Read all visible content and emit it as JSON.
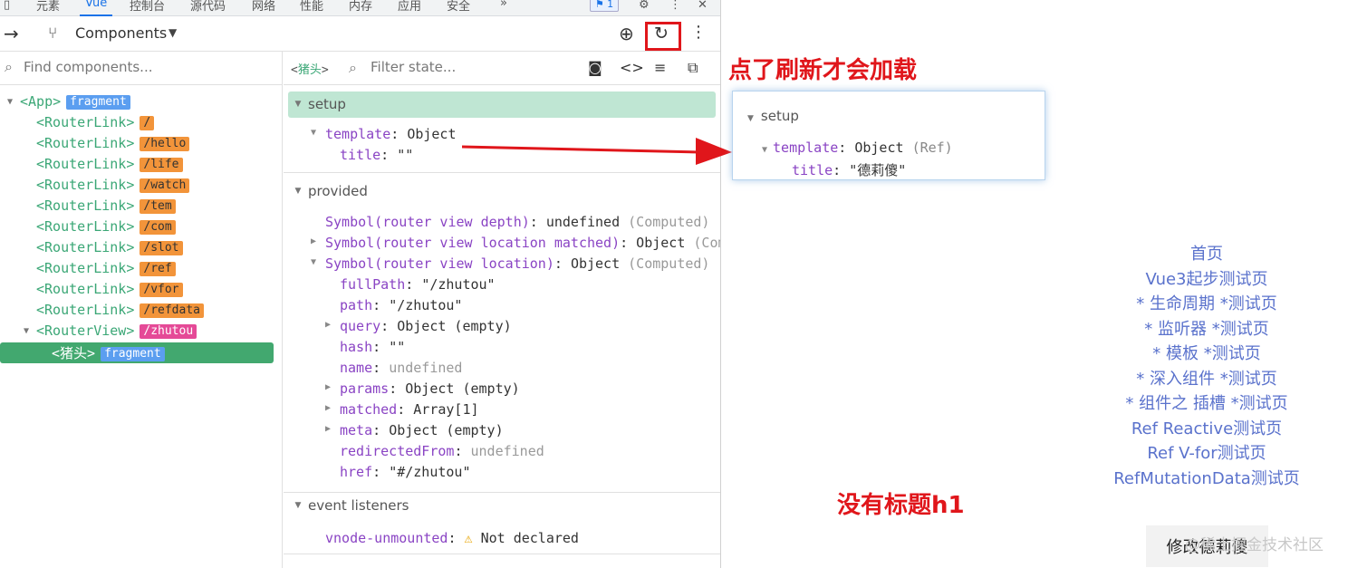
{
  "devtools": {
    "tabs": [
      "元素",
      "Vue",
      "控制台",
      "源代码",
      "网络",
      "性能",
      "内存",
      "应用",
      "安全",
      "»"
    ],
    "issues_badge": "1",
    "toolbar": {
      "components_label": "Components"
    },
    "component_search_placeholder": "Find components...",
    "tree": [
      {
        "name": "<App>",
        "badge": "fragment",
        "badge_color": "blue"
      },
      {
        "name": "<RouterLink>",
        "badge": "/",
        "badge_color": "orange"
      },
      {
        "name": "<RouterLink>",
        "badge": "/hello",
        "badge_color": "orange"
      },
      {
        "name": "<RouterLink>",
        "badge": "/life",
        "badge_color": "orange"
      },
      {
        "name": "<RouterLink>",
        "badge": "/watch",
        "badge_color": "orange"
      },
      {
        "name": "<RouterLink>",
        "badge": "/tem",
        "badge_color": "orange"
      },
      {
        "name": "<RouterLink>",
        "badge": "/com",
        "badge_color": "orange"
      },
      {
        "name": "<RouterLink>",
        "badge": "/slot",
        "badge_color": "orange"
      },
      {
        "name": "<RouterLink>",
        "badge": "/ref",
        "badge_color": "orange"
      },
      {
        "name": "<RouterLink>",
        "badge": "/vfor",
        "badge_color": "orange"
      },
      {
        "name": "<RouterLink>",
        "badge": "/refdata",
        "badge_color": "orange"
      },
      {
        "name": "<RouterView>",
        "badge": "/zhutou",
        "badge_color": "pink"
      },
      {
        "name": "<猪头>",
        "badge": "fragment",
        "badge_color": "blue"
      }
    ],
    "state": {
      "breadcrumb_open": "<",
      "breadcrumb_name": "猪头",
      "breadcrumb_close": ">",
      "filter_placeholder": "Filter state...",
      "setup_label": "setup",
      "template_key": "template",
      "template_val": "Object",
      "title_key": "title",
      "title_val": "\"\"",
      "provided_label": "provided",
      "provided": [
        {
          "k": "Symbol(router view depth)",
          "v": "undefined",
          "g": "(Computed)"
        },
        {
          "k": "Symbol(router view location matched)",
          "v": "Object",
          "g": "(Computed)"
        },
        {
          "k": "Symbol(router view location)",
          "v": "Object",
          "g": "(Computed)"
        }
      ],
      "location": [
        {
          "k": "fullPath",
          "v": "\"/zhutou\"",
          "g": ""
        },
        {
          "k": "path",
          "v": "\"/zhutou\"",
          "g": ""
        },
        {
          "k": "query",
          "v": "Object (empty)",
          "g": ""
        },
        {
          "k": "hash",
          "v": "\"\"",
          "g": ""
        },
        {
          "k": "name",
          "v": "",
          "g": "undefined"
        },
        {
          "k": "params",
          "v": "Object (empty)",
          "g": ""
        },
        {
          "k": "matched",
          "v": "Array[1]",
          "g": ""
        },
        {
          "k": "meta",
          "v": "Object (empty)",
          "g": ""
        },
        {
          "k": "redirectedFrom",
          "v": "",
          "g": "undefined"
        },
        {
          "k": "href",
          "v": "\"#/zhutou\"",
          "g": ""
        }
      ],
      "events_label": "event listeners",
      "event_key": "vnode-unmounted",
      "event_val": "Not declared"
    }
  },
  "annotations": {
    "top": "点了刷新才会加载",
    "bottom": "没有标题h1"
  },
  "popup": {
    "setup_label": "setup",
    "template_key": "template",
    "template_val": "Object",
    "template_ref": "(Ref)",
    "title_key": "title",
    "title_val": "\"德莉傻\""
  },
  "app": {
    "nav": [
      "首页",
      "Vue3起步测试页",
      "* 生命周期 *测试页",
      "* 监听器 *测试页",
      "* 模板 *测试页",
      "* 深入组件 *测试页",
      "* 组件之 插槽 *测试页",
      "Ref Reactive测试页",
      "Ref V-for测试页",
      "RefMutationData测试页"
    ],
    "edit_button": "修改德莉傻",
    "watermark": "@稀土掘金技术社区"
  },
  "colors": {
    "accent": "#1a73e8",
    "vue_green": "#42a86f",
    "annotation_red": "#e0161b",
    "link": "#5a72cc"
  }
}
